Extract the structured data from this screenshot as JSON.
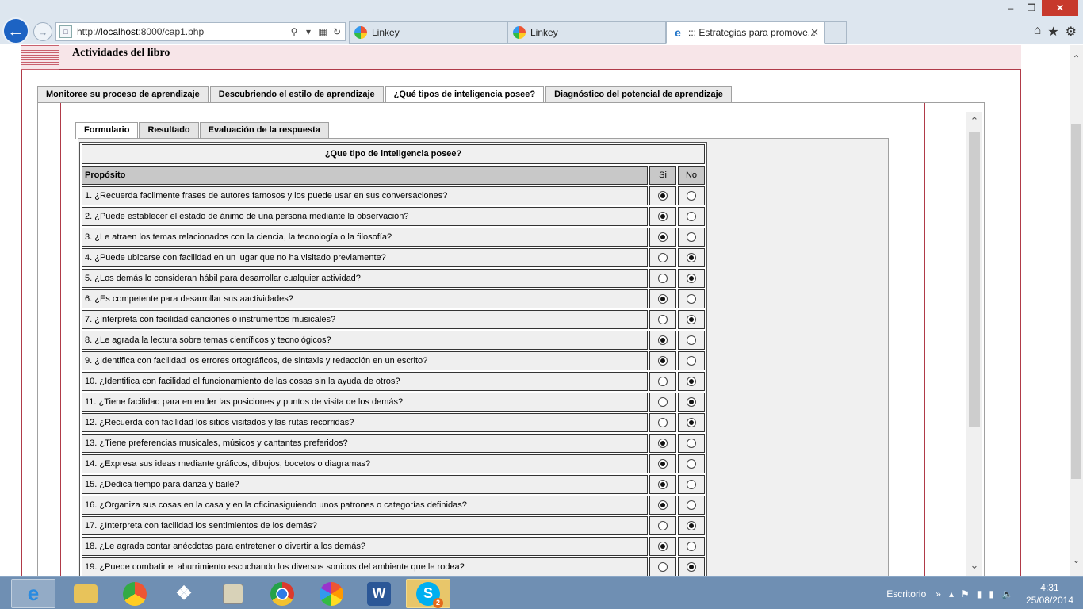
{
  "browser": {
    "url_prefix": "http://",
    "url_host": "localhost",
    "url_rest": ":8000/cap1.php",
    "tabs": [
      {
        "label": "Linkey"
      },
      {
        "label": "Linkey"
      },
      {
        "label": "::: Estrategias para promove..."
      }
    ]
  },
  "page": {
    "title": "Actividades del libro",
    "main_tabs": [
      "Monitoree su proceso de aprendizaje",
      "Descubriendo el estilo de aprendizaje",
      "¿Qué tipos de inteligencia posee?",
      "Diagnóstico del potencial de aprendizaje"
    ],
    "sub_tabs": [
      "Formulario",
      "Resultado",
      "Evaluación de la respuesta"
    ]
  },
  "quiz": {
    "title": "¿Que tipo de inteligencia posee?",
    "col_question": "Propósito",
    "col_yes": "Si",
    "col_no": "No",
    "questions": [
      {
        "text": "1. ¿Recuerda facilmente frases de autores famosos y los puede usar en sus conversaciones?",
        "answer": "si"
      },
      {
        "text": "2. ¿Puede establecer el estado de ánimo de una persona mediante la observación?",
        "answer": "si"
      },
      {
        "text": "3. ¿Le atraen los temas relacionados con la ciencia, la tecnología o la filosofía?",
        "answer": "si"
      },
      {
        "text": "4. ¿Puede ubicarse con facilidad en un lugar que no ha visitado previamente?",
        "answer": "no"
      },
      {
        "text": "5. ¿Los demás lo consideran hábil para desarrollar cualquier actividad?",
        "answer": "no"
      },
      {
        "text": "6. ¿Es competente para desarrollar sus aactividades?",
        "answer": "si"
      },
      {
        "text": "7. ¿Interpreta con facilidad canciones o instrumentos musicales?",
        "answer": "no"
      },
      {
        "text": "8. ¿Le agrada la lectura sobre temas científicos y tecnológicos?",
        "answer": "si"
      },
      {
        "text": "9. ¿Identifica con facilidad los errores ortográficos, de sintaxis y redacción en un escrito?",
        "answer": "si"
      },
      {
        "text": "10. ¿Identifica con facilidad el funcionamiento de las cosas sin la ayuda de otros?",
        "answer": "no"
      },
      {
        "text": "11. ¿Tiene facilidad para entender las posiciones y puntos de visita de los demás?",
        "answer": "no"
      },
      {
        "text": "12. ¿Recuerda con facilidad los sitios visitados y las rutas recorridas?",
        "answer": "no"
      },
      {
        "text": "13. ¿Tiene preferencias musicales, músicos y cantantes preferidos?",
        "answer": "si"
      },
      {
        "text": "14. ¿Expresa sus ideas mediante gráficos, dibujos, bocetos o diagramas?",
        "answer": "si"
      },
      {
        "text": "15. ¿Dedica tiempo para danza y baile?",
        "answer": "si"
      },
      {
        "text": "16. ¿Organiza sus cosas en la casa y en la oficinasiguiendo unos patrones o categorías definidas?",
        "answer": "si"
      },
      {
        "text": "17. ¿Interpreta con facilidad los sentimientos de los demás?",
        "answer": "no"
      },
      {
        "text": "18. ¿Le agrada contar anécdotas para entretener o divertir a los demás?",
        "answer": "si"
      },
      {
        "text": "19. ¿Puede combatir el aburrimiento escuchando los diversos sonidos del ambiente que le rodea?",
        "answer": "no"
      }
    ]
  },
  "taskbar": {
    "desktop_label": "Escritorio",
    "time": "4:31",
    "date": "25/08/2014",
    "skype_badge": "2"
  }
}
